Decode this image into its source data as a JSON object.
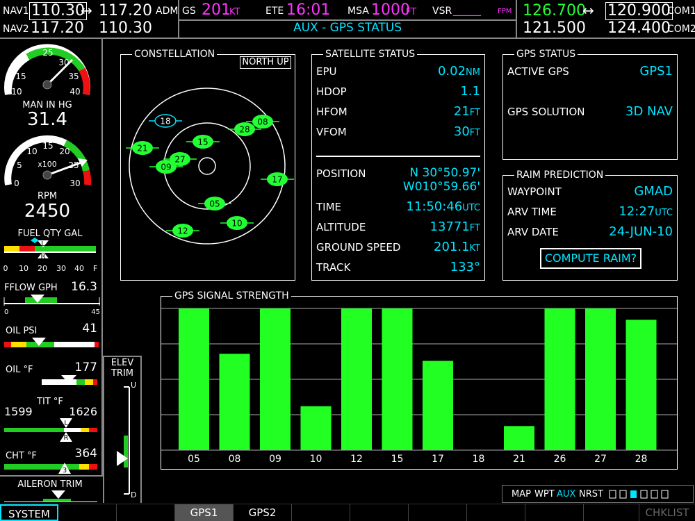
{
  "topbar": {
    "nav1_label": "NAV1",
    "nav1_active": "110.30",
    "nav1_arrow": "↔",
    "nav1_standby": "117.20",
    "nav1_id": "ADM",
    "nav2_label": "NAV2",
    "nav2_active": "117.20",
    "nav2_standby": "110.30",
    "gs_label": "GS",
    "gs_value": "201",
    "gs_unit": "KT",
    "ete_label": "ETE",
    "ete_value": "16:01",
    "msa_label": "MSA",
    "msa_value": "1000",
    "msa_unit": "FT",
    "vsr_label": "VSR",
    "vsr_value": "_____",
    "vsr_unit": "FPM",
    "page_title": "AUX - GPS STATUS",
    "com1_active": "126.700",
    "com1_arrow": "↔",
    "com1_standby": "120.900",
    "com1_label": "COM1",
    "com2_active": "121.500",
    "com2_standby": "124.400",
    "com2_label": "COM2"
  },
  "gauges": {
    "man_ticks": [
      "10",
      "15",
      "25",
      "30",
      "35",
      "40"
    ],
    "man_label": "MAN IN HG",
    "man_value": "31.4",
    "rpm_ticks": [
      "0",
      "5",
      "10",
      "15",
      "20",
      "25",
      "30"
    ],
    "rpm_mult": "x100",
    "rpm_label": "RPM",
    "rpm_value": "2450",
    "fuel_label": "FUEL QTY GAL",
    "fuel_ticks": [
      "0",
      "10",
      "20",
      "30",
      "40",
      "F"
    ],
    "fuel_left": "L",
    "fuel_right": "R",
    "fflow_label": "FFLOW GPH",
    "fflow_value": "16.3",
    "fflow_min": "0",
    "fflow_max": "45",
    "oilp_label": "OIL PSI",
    "oilp_value": "41",
    "oilt_label": "OIL °F",
    "oilt_value": "177",
    "tit_label": "TIT °F",
    "tit_left": "1599",
    "tit_right": "1626",
    "cht_label": "CHT °F",
    "cht_value": "364",
    "cht_cyl": "3",
    "aileron_label": "AILERON TRIM",
    "elev_label_1": "ELEV",
    "elev_label_2": "TRIM",
    "elev_up": "U",
    "elev_down": "D"
  },
  "constellation": {
    "title": "CONSTELLATION",
    "orientation": "NORTH UP",
    "satellites": [
      {
        "id": "18",
        "style": "outline"
      },
      {
        "id": "08",
        "style": "filled"
      },
      {
        "id": "28",
        "style": "filled"
      },
      {
        "id": "15",
        "style": "filled"
      },
      {
        "id": "21",
        "style": "filled"
      },
      {
        "id": "27",
        "style": "filled"
      },
      {
        "id": "09",
        "style": "filled"
      },
      {
        "id": "17",
        "style": "filled"
      },
      {
        "id": "05",
        "style": "filled"
      },
      {
        "id": "10",
        "style": "filled"
      },
      {
        "id": "12",
        "style": "filled"
      }
    ]
  },
  "satellite_status": {
    "title": "SATELLITE STATUS",
    "epu_label": "EPU",
    "epu_value": "0.02",
    "epu_unit": "NM",
    "hdop_label": "HDOP",
    "hdop_value": "1.1",
    "hfom_label": "HFOM",
    "hfom_value": "21",
    "hfom_unit": "FT",
    "vfom_label": "VFOM",
    "vfom_value": "30",
    "vfom_unit": "FT",
    "position_label": "POSITION",
    "position_lat": "N 30°50.97'",
    "position_lon": "W010°59.66'",
    "time_label": "TIME",
    "time_value": "11:50:46",
    "time_unit": "UTC",
    "altitude_label": "ALTITUDE",
    "altitude_value": "13771",
    "altitude_unit": "FT",
    "gs_label": "GROUND SPEED",
    "gs_value": "201.1",
    "gs_unit": "KT",
    "track_label": "TRACK",
    "track_value": "133°"
  },
  "gps_status": {
    "title": "GPS STATUS",
    "active_label": "ACTIVE GPS",
    "active_value": "GPS1",
    "solution_label": "GPS SOLUTION",
    "solution_value": "3D NAV"
  },
  "raim": {
    "title": "RAIM PREDICTION",
    "waypoint_label": "WAYPOINT",
    "waypoint_value": "GMAD",
    "arv_time_label": "ARV TIME",
    "arv_time_value": "12:27",
    "arv_time_unit": "UTC",
    "arv_date_label": "ARV DATE",
    "arv_date_value": "24-JUN-10",
    "compute_button": "COMPUTE RAIM?"
  },
  "chart_data": {
    "type": "bar",
    "title": "GPS SIGNAL STRENGTH",
    "categories": [
      "05",
      "08",
      "09",
      "10",
      "12",
      "15",
      "17",
      "18",
      "21",
      "26",
      "27",
      "28"
    ],
    "values": [
      100,
      68,
      100,
      31,
      100,
      100,
      63,
      0,
      17,
      100,
      100,
      92
    ],
    "ylim": [
      0,
      100
    ],
    "grid": true,
    "bar_color": "#22ff22"
  },
  "page_group": {
    "items": [
      "MAP",
      "WPT",
      "AUX",
      "NRST"
    ],
    "active": "AUX"
  },
  "softkeys": {
    "system": "SYSTEM",
    "gps1": "GPS1",
    "gps2": "GPS2",
    "chklist": "CHKLIST"
  },
  "colors": {
    "cyan": "#00e5ff",
    "magenta": "#ff33ff",
    "green": "#22ff33",
    "bar_green": "#22ff22"
  }
}
